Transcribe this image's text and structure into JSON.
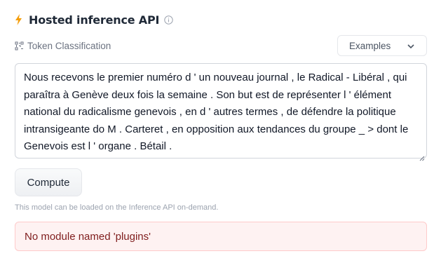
{
  "widget": {
    "title": "Hosted inference API",
    "bolt_icon": "lightning-bolt-icon",
    "bolt_color": "#f59e0b",
    "info_icon": "info-circle-icon"
  },
  "task": {
    "icon": "token-classification-icon",
    "label": "Token Classification"
  },
  "examples": {
    "label": "Examples",
    "icon": "chevron-down-icon"
  },
  "input": {
    "value": "Nous recevons le premier numéro d ' un nouveau journal , le Radical - Libéral , qui paraîtra à Genève deux fois la semaine . Son but est de représenter l ' élément national du radicalisme genevois , en d ' autres termes , de défendre la politique intransigeante do M . Carteret , en opposition aux tendances du groupe _ > dont le Genevois est l ' organe . Bétail ."
  },
  "compute_button": {
    "label": "Compute"
  },
  "note": "This model can be loaded on the Inference API on-demand.",
  "error": {
    "message": "No module named 'plugins'",
    "bg_color": "#fef2f2",
    "text_color": "#7f1d1d"
  }
}
